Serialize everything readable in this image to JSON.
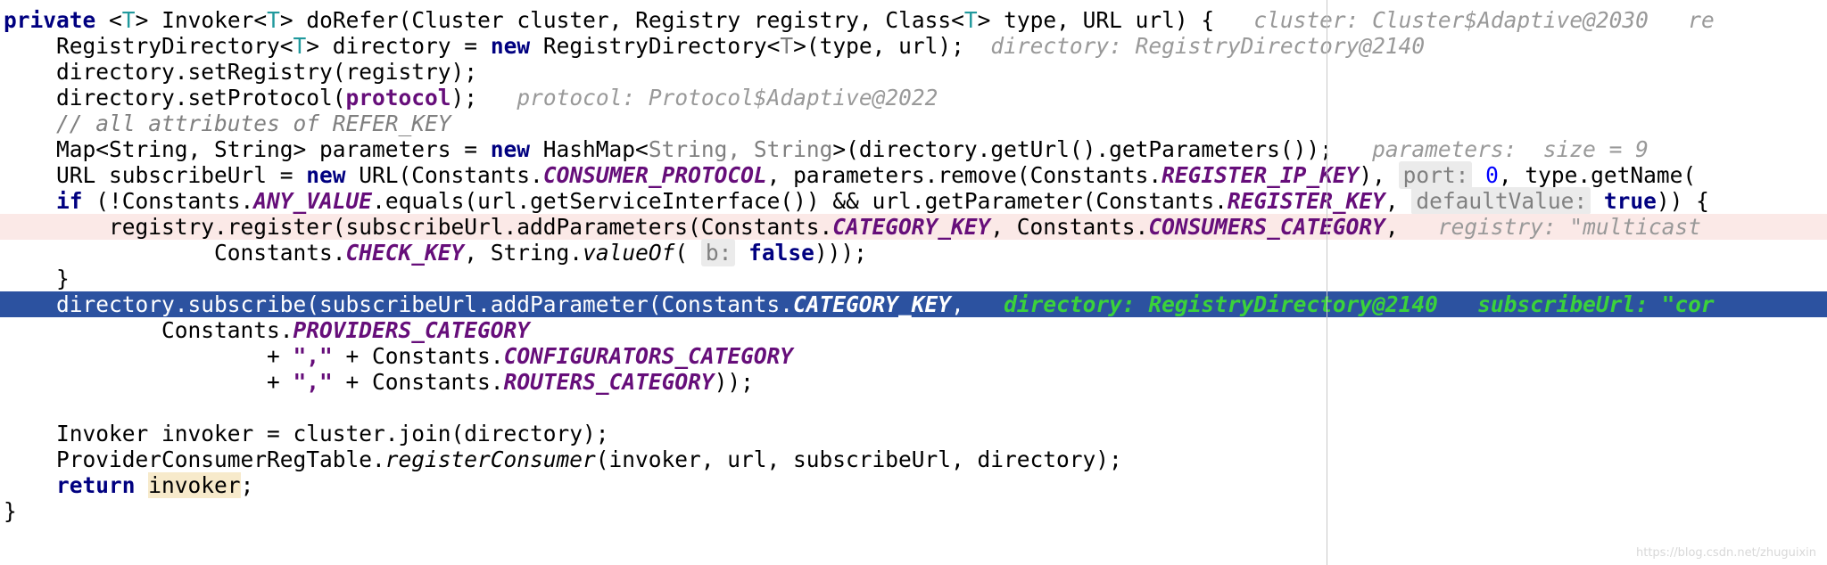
{
  "editor": {
    "language": "java",
    "margin_guide_x": 1487,
    "watermark": "https://blog.csdn.net/zhuguixin",
    "colors": {
      "background": "#ffffff",
      "keyword": "#000080",
      "static_field": "#660e7a",
      "comment_gray": "#808080",
      "inlay_hint": "#999999",
      "selection_bg": "#2c52a0",
      "selection_hint": "#3bd23b",
      "execution_point_bg": "#fbe9e7",
      "identifier_highlight_bg": "#f7eacb",
      "margin_guide": "#c9c9c9"
    },
    "lines": [
      {
        "id": "line-1",
        "indent": 0,
        "highlight": "none",
        "tokens": [
          {
            "t": "private",
            "c": "kw"
          },
          {
            "t": " ",
            "c": "plain"
          },
          {
            "t": "<",
            "c": "plain"
          },
          {
            "t": "T",
            "c": "generic"
          },
          {
            "t": "> Invoker<",
            "c": "plain"
          },
          {
            "t": "T",
            "c": "generic"
          },
          {
            "t": "> doRefer(Cluster cluster, Registry registry, Class<",
            "c": "plain"
          },
          {
            "t": "T",
            "c": "generic"
          },
          {
            "t": "> type, URL url) {",
            "c": "plain"
          },
          {
            "t": "   ",
            "c": "plain"
          },
          {
            "t": "cluster:",
            "c": "hintlbl"
          },
          {
            "t": " Cluster$Adaptive@2030",
            "c": "hintval"
          },
          {
            "t": "   ",
            "c": "plain"
          },
          {
            "t": "re",
            "c": "hintval"
          }
        ]
      },
      {
        "id": "line-2",
        "indent": 1,
        "highlight": "none",
        "tokens": [
          {
            "t": "RegistryDirectory<",
            "c": "plain"
          },
          {
            "t": "T",
            "c": "generic"
          },
          {
            "t": "> directory = ",
            "c": "plain"
          },
          {
            "t": "new",
            "c": "kw"
          },
          {
            "t": " RegistryDirectory<",
            "c": "plain"
          },
          {
            "t": "T",
            "c": "generic-g"
          },
          {
            "t": ">(type, url);",
            "c": "plain"
          },
          {
            "t": "  ",
            "c": "plain"
          },
          {
            "t": "directory:",
            "c": "hintlbl"
          },
          {
            "t": " RegistryDirectory@2140",
            "c": "hintval"
          }
        ]
      },
      {
        "id": "line-3",
        "indent": 1,
        "highlight": "none",
        "tokens": [
          {
            "t": "directory.setRegistry(registry);",
            "c": "plain"
          }
        ]
      },
      {
        "id": "line-4",
        "indent": 1,
        "highlight": "none",
        "tokens": [
          {
            "t": "directory.setProtocol(",
            "c": "plain"
          },
          {
            "t": "protocol",
            "c": "fieldpl"
          },
          {
            "t": ");",
            "c": "plain"
          },
          {
            "t": "   ",
            "c": "plain"
          },
          {
            "t": "protocol:",
            "c": "hintlbl"
          },
          {
            "t": " Protocol$Adaptive@2022",
            "c": "hintval"
          }
        ]
      },
      {
        "id": "line-5",
        "indent": 1,
        "highlight": "none",
        "tokens": [
          {
            "t": "// all attributes of REFER_KEY",
            "c": "comment"
          }
        ]
      },
      {
        "id": "line-6",
        "indent": 1,
        "highlight": "none",
        "tokens": [
          {
            "t": "Map<String, String> parameters = ",
            "c": "plain"
          },
          {
            "t": "new",
            "c": "kw"
          },
          {
            "t": " HashMap<",
            "c": "plain"
          },
          {
            "t": "String, String",
            "c": "generic-g"
          },
          {
            "t": ">(directory.getUrl().getParameters());",
            "c": "plain"
          },
          {
            "t": "   ",
            "c": "plain"
          },
          {
            "t": "parameters:",
            "c": "hintlbl"
          },
          {
            "t": "  size = 9",
            "c": "hintval"
          }
        ]
      },
      {
        "id": "line-7",
        "indent": 1,
        "highlight": "none",
        "tokens": [
          {
            "t": "URL subscribeUrl = ",
            "c": "plain"
          },
          {
            "t": "new",
            "c": "kw"
          },
          {
            "t": " URL(Constants.",
            "c": "plain"
          },
          {
            "t": "CONSUMER_PROTOCOL",
            "c": "field"
          },
          {
            "t": ", parameters.remove(Constants.",
            "c": "plain"
          },
          {
            "t": "REGISTER_IP_KEY",
            "c": "field"
          },
          {
            "t": "), ",
            "c": "plain"
          },
          {
            "t": "port:",
            "c": "chip"
          },
          {
            "t": " ",
            "c": "plain"
          },
          {
            "t": "0",
            "c": "num-blue"
          },
          {
            "t": ", type.getName(",
            "c": "plain"
          }
        ]
      },
      {
        "id": "line-8",
        "indent": 1,
        "highlight": "none",
        "tokens": [
          {
            "t": "if",
            "c": "kw"
          },
          {
            "t": " (!Constants.",
            "c": "plain"
          },
          {
            "t": "ANY_VALUE",
            "c": "field"
          },
          {
            "t": ".equals(url.getServiceInterface()) && url.getParameter(Constants.",
            "c": "plain"
          },
          {
            "t": "REGISTER_KEY",
            "c": "field"
          },
          {
            "t": ", ",
            "c": "plain"
          },
          {
            "t": "defaultValue:",
            "c": "chip"
          },
          {
            "t": " ",
            "c": "plain"
          },
          {
            "t": "true",
            "c": "kw-inline"
          },
          {
            "t": ")) {",
            "c": "plain"
          }
        ]
      },
      {
        "id": "line-9",
        "indent": 2,
        "highlight": "pink",
        "tokens": [
          {
            "t": "registry.register(subscribeUrl.addParameters(Constants.",
            "c": "plain"
          },
          {
            "t": "CATEGORY_KEY",
            "c": "field"
          },
          {
            "t": ", Constants.",
            "c": "plain"
          },
          {
            "t": "CONSUMERS_CATEGORY",
            "c": "field"
          },
          {
            "t": ",",
            "c": "plain"
          },
          {
            "t": "   ",
            "c": "plain"
          },
          {
            "t": "registry:",
            "c": "hintlbl"
          },
          {
            "t": " \"multicast",
            "c": "hintval"
          }
        ]
      },
      {
        "id": "line-10",
        "indent": 4,
        "highlight": "none",
        "tokens": [
          {
            "t": "Constants.",
            "c": "plain"
          },
          {
            "t": "CHECK_KEY",
            "c": "field"
          },
          {
            "t": ", String.",
            "c": "plain"
          },
          {
            "t": "valueOf",
            "c": "method"
          },
          {
            "t": "( ",
            "c": "plain"
          },
          {
            "t": "b:",
            "c": "chip"
          },
          {
            "t": " ",
            "c": "plain"
          },
          {
            "t": "false",
            "c": "kw-inline"
          },
          {
            "t": ")));",
            "c": "plain"
          }
        ]
      },
      {
        "id": "line-11",
        "indent": 1,
        "highlight": "none",
        "tokens": [
          {
            "t": "}",
            "c": "plain"
          }
        ]
      },
      {
        "id": "line-12",
        "indent": 1,
        "highlight": "select",
        "tokens": [
          {
            "t": "directory.subscribe(subscribeUrl.addParameter(Constants.",
            "c": "sel-text"
          },
          {
            "t": "CATEGORY_KEY",
            "c": "sel-field"
          },
          {
            "t": ",",
            "c": "sel-text"
          },
          {
            "t": "   ",
            "c": "sel-text"
          },
          {
            "t": "directory: RegistryDirectory@2140",
            "c": "sel-hint"
          },
          {
            "t": "   ",
            "c": "sel-text"
          },
          {
            "t": "subscribeUrl: \"cor",
            "c": "sel-hint"
          }
        ]
      },
      {
        "id": "line-13",
        "indent": 3,
        "highlight": "none",
        "tokens": [
          {
            "t": "Constants.",
            "c": "plain"
          },
          {
            "t": "PROVIDERS_CATEGORY",
            "c": "field"
          }
        ]
      },
      {
        "id": "line-14",
        "indent": 5,
        "highlight": "none",
        "tokens": [
          {
            "t": "+ ",
            "c": "plain"
          },
          {
            "t": "\",\"",
            "c": "fieldpl"
          },
          {
            "t": " + Constants.",
            "c": "plain"
          },
          {
            "t": "CONFIGURATORS_CATEGORY",
            "c": "field"
          }
        ]
      },
      {
        "id": "line-15",
        "indent": 5,
        "highlight": "none",
        "tokens": [
          {
            "t": "+ ",
            "c": "plain"
          },
          {
            "t": "\",\"",
            "c": "fieldpl"
          },
          {
            "t": " + Constants.",
            "c": "plain"
          },
          {
            "t": "ROUTERS_CATEGORY",
            "c": "field"
          },
          {
            "t": "));",
            "c": "plain"
          }
        ]
      },
      {
        "id": "line-16",
        "indent": 0,
        "highlight": "none",
        "tokens": []
      },
      {
        "id": "line-17",
        "indent": 1,
        "highlight": "none",
        "tokens": [
          {
            "t": "Invoker invoker = cluster.join(directory);",
            "c": "plain"
          }
        ]
      },
      {
        "id": "line-18",
        "indent": 1,
        "highlight": "none",
        "tokens": [
          {
            "t": "ProviderConsumerRegTable.",
            "c": "plain"
          },
          {
            "t": "registerConsumer",
            "c": "method"
          },
          {
            "t": "(invoker, url, subscribeUrl, directory);",
            "c": "plain"
          }
        ]
      },
      {
        "id": "line-19",
        "indent": 1,
        "highlight": "none",
        "tokens": [
          {
            "t": "return",
            "c": "kw"
          },
          {
            "t": " ",
            "c": "plain"
          },
          {
            "t": "invoker",
            "c": "ident-hl"
          },
          {
            "t": ";",
            "c": "plain"
          }
        ]
      },
      {
        "id": "line-20",
        "indent": 0,
        "highlight": "none",
        "tokens": [
          {
            "t": "}",
            "c": "plain"
          }
        ]
      }
    ]
  }
}
